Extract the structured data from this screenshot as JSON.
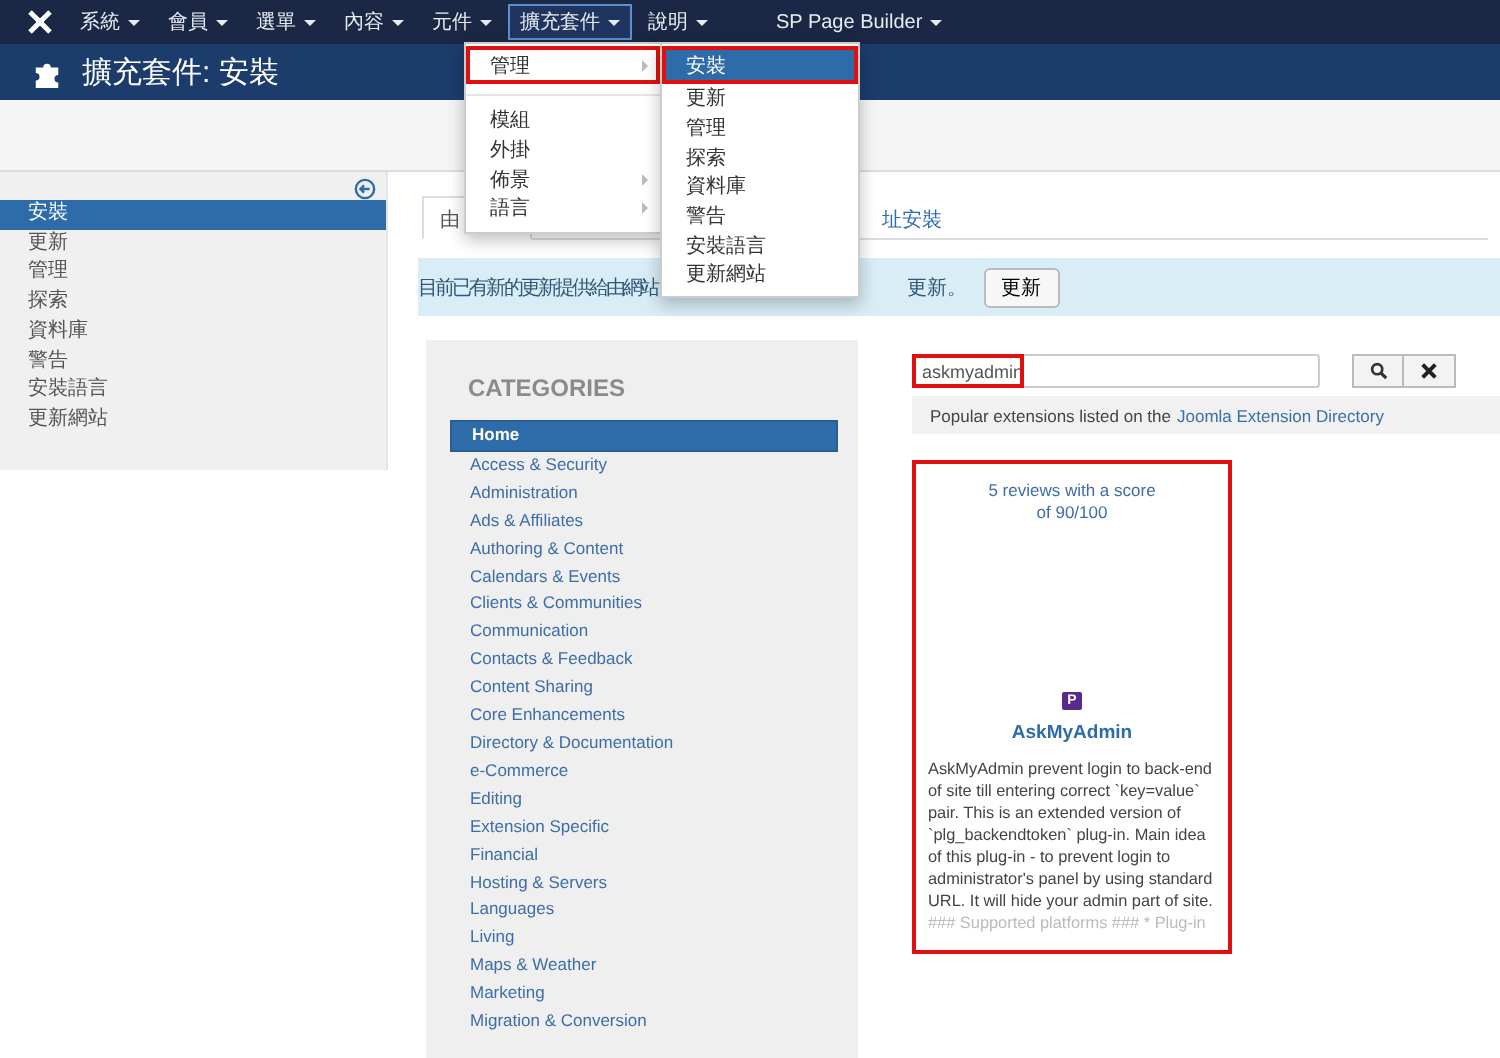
{
  "navbar": {
    "items": [
      {
        "label": "系統",
        "active": false
      },
      {
        "label": "會員",
        "active": false
      },
      {
        "label": "選單",
        "active": false
      },
      {
        "label": "內容",
        "active": false
      },
      {
        "label": "元件",
        "active": false
      },
      {
        "label": "擴充套件",
        "active": true
      },
      {
        "label": "說明",
        "active": false
      },
      {
        "label": "SP Page Builder",
        "active": false
      }
    ]
  },
  "dropdown": {
    "items": [
      {
        "kind": "item",
        "label": "管理",
        "submenu": true,
        "highlighted": true
      },
      {
        "kind": "divider"
      },
      {
        "kind": "item",
        "label": "模組",
        "submenu": false,
        "highlighted": false
      },
      {
        "kind": "item",
        "label": "外掛",
        "submenu": false,
        "highlighted": false
      },
      {
        "kind": "item",
        "label": "佈景",
        "submenu": true,
        "highlighted": false
      },
      {
        "kind": "item",
        "label": "語言",
        "submenu": true,
        "highlighted": false
      }
    ]
  },
  "submenu": {
    "items": [
      {
        "label": "安裝",
        "selected": true,
        "highlighted": true
      },
      {
        "label": "更新",
        "selected": false,
        "highlighted": false
      },
      {
        "label": "管理",
        "selected": false,
        "highlighted": false
      },
      {
        "label": "探索",
        "selected": false,
        "highlighted": false
      },
      {
        "label": "資料庫",
        "selected": false,
        "highlighted": false
      },
      {
        "label": "警告",
        "selected": false,
        "highlighted": false
      },
      {
        "label": "安裝語言",
        "selected": false,
        "highlighted": false
      },
      {
        "label": "更新網站",
        "selected": false,
        "highlighted": false
      }
    ]
  },
  "header": {
    "title": "擴充套件: 安裝"
  },
  "sidebar": {
    "items": [
      {
        "label": "安裝",
        "selected": true
      },
      {
        "label": "更新",
        "selected": false
      },
      {
        "label": "管理",
        "selected": false
      },
      {
        "label": "探索",
        "selected": false
      },
      {
        "label": "資料庫",
        "selected": false
      },
      {
        "label": "警告",
        "selected": false
      },
      {
        "label": "安裝語言",
        "selected": false
      },
      {
        "label": "更新網站",
        "selected": false
      }
    ]
  },
  "tabs": [
    {
      "label": "由",
      "selected": true
    },
    {
      "label": "址安裝",
      "selected": false
    }
  ],
  "alert": {
    "text_start": "目前已有新的更新提供給由網站",
    "text_end": "更新。",
    "button": "更新"
  },
  "categories": {
    "title": "CATEGORIES",
    "items": [
      {
        "label": "Home",
        "selected": true
      },
      {
        "label": "Access & Security",
        "selected": false
      },
      {
        "label": "Administration",
        "selected": false
      },
      {
        "label": "Ads & Affiliates",
        "selected": false
      },
      {
        "label": "Authoring & Content",
        "selected": false
      },
      {
        "label": "Calendars & Events",
        "selected": false
      },
      {
        "label": "Clients & Communities",
        "selected": false
      },
      {
        "label": "Communication",
        "selected": false
      },
      {
        "label": "Contacts & Feedback",
        "selected": false
      },
      {
        "label": "Content Sharing",
        "selected": false
      },
      {
        "label": "Core Enhancements",
        "selected": false
      },
      {
        "label": "Directory & Documentation",
        "selected": false
      },
      {
        "label": "e-Commerce",
        "selected": false
      },
      {
        "label": "Editing",
        "selected": false
      },
      {
        "label": "Extension Specific",
        "selected": false
      },
      {
        "label": "Financial",
        "selected": false
      },
      {
        "label": "Hosting & Servers",
        "selected": false
      },
      {
        "label": "Languages",
        "selected": false
      },
      {
        "label": "Living",
        "selected": false
      },
      {
        "label": "Maps & Weather",
        "selected": false
      },
      {
        "label": "Marketing",
        "selected": false
      },
      {
        "label": "Migration & Conversion",
        "selected": false
      }
    ]
  },
  "search": {
    "value": "askmyadmin",
    "highlighted": true
  },
  "popular": {
    "text": "Popular extensions listed on the",
    "link": "Joomla Extension Directory"
  },
  "card": {
    "highlighted": true,
    "reviews": "5 reviews with a score of 90/100",
    "badge": "P",
    "name": "AskMyAdmin",
    "description": "AskMyAdmin prevent login to back-end of site till entering correct `key=value` pair. This is an extended version of `plg_backendtoken` plug-in. Main idea of this plug-in - to prevent login to administrator's panel by using standard URL. It will hide your admin part of site.",
    "description_faded": "### Supported platforms ### * Plug-in"
  }
}
